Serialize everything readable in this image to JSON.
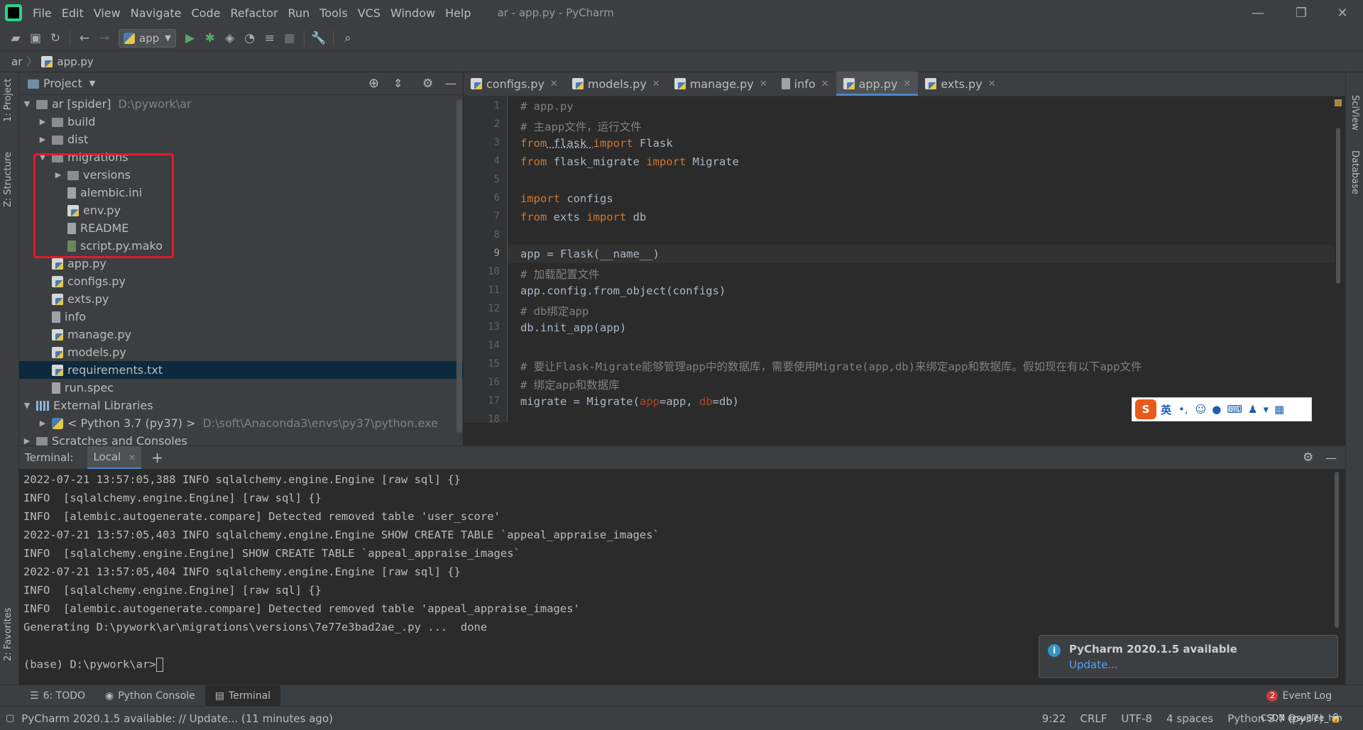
{
  "window": {
    "title": "ar - app.py - PyCharm"
  },
  "menu": [
    "File",
    "Edit",
    "View",
    "Navigate",
    "Code",
    "Refactor",
    "Run",
    "Tools",
    "VCS",
    "Window",
    "Help"
  ],
  "toolbar": {
    "run_config": "app"
  },
  "breadcrumb": {
    "root": "ar",
    "file": "app.py"
  },
  "left_strip": {
    "project": "1: Project",
    "structure": "Z: Structure",
    "favorites": "2: Favorites"
  },
  "right_strip": {
    "sciview": "SciView",
    "database": "Database"
  },
  "project_panel": {
    "title": "Project"
  },
  "tree": [
    {
      "label": "ar [spider]",
      "path": "D:\\pywork\\ar",
      "icon": "folder-icon",
      "arrow": "▼"
    },
    {
      "label": "build",
      "icon": "folder-icon",
      "arrow": "▶"
    },
    {
      "label": "dist",
      "icon": "folder-icon",
      "arrow": "▶"
    },
    {
      "label": "migrations",
      "icon": "folder-icon",
      "arrow": "▼"
    },
    {
      "label": "versions",
      "icon": "folder-icon",
      "arrow": "▶"
    },
    {
      "label": "alembic.ini",
      "icon": "ini-file-icon",
      "arrow": ""
    },
    {
      "label": "env.py",
      "icon": "python-file-icon",
      "arrow": ""
    },
    {
      "label": "README",
      "icon": "text-file-icon",
      "arrow": ""
    },
    {
      "label": "script.py.mako",
      "icon": "mako-file-icon",
      "arrow": ""
    },
    {
      "label": "app.py",
      "icon": "python-file-icon",
      "arrow": ""
    },
    {
      "label": "configs.py",
      "icon": "python-file-icon",
      "arrow": ""
    },
    {
      "label": "exts.py",
      "icon": "python-file-icon",
      "arrow": ""
    },
    {
      "label": "info",
      "icon": "text-file-icon",
      "arrow": ""
    },
    {
      "label": "manage.py",
      "icon": "python-file-icon",
      "arrow": ""
    },
    {
      "label": "models.py",
      "icon": "python-file-icon",
      "arrow": ""
    },
    {
      "label": "requirements.txt",
      "icon": "requirements-file-icon",
      "arrow": ""
    },
    {
      "label": "run.spec",
      "icon": "text-file-icon",
      "arrow": ""
    },
    {
      "label": "External Libraries",
      "icon": "library-icon",
      "arrow": "▼"
    },
    {
      "label": "< Python 3.7 (py37) >",
      "path": "D:\\soft\\Anaconda3\\envs\\py37\\python.exe",
      "icon": "python-sdk-icon",
      "arrow": "▶"
    },
    {
      "label": "Scratches and Consoles",
      "icon": "scratches-icon",
      "arrow": "▶"
    }
  ],
  "editor_tabs": [
    {
      "label": "configs.py",
      "active": false
    },
    {
      "label": "models.py",
      "active": false
    },
    {
      "label": "manage.py",
      "active": false
    },
    {
      "label": "info",
      "active": false
    },
    {
      "label": "app.py",
      "active": true
    },
    {
      "label": "exts.py",
      "active": false
    }
  ],
  "code_line_numbers": [
    "1",
    "2",
    "3",
    "4",
    "5",
    "6",
    "7",
    "8",
    "9",
    "10",
    "11",
    "12",
    "13",
    "14",
    "15",
    "16",
    "17",
    "18"
  ],
  "code": {
    "l1": "# app.py",
    "l2": "# 主app文件，运行文件",
    "l3a": "from",
    "l3b": " flask ",
    "l3c": "import",
    "l3d": " Flask",
    "l4a": "from",
    "l4b": " flask_migrate ",
    "l4c": "import",
    "l4d": " Migrate",
    "l6a": "import",
    "l6b": " configs",
    "l7a": "from",
    "l7b": " exts ",
    "l7c": "import",
    "l7d": " db",
    "l9": "app = Flask(__name__)",
    "l10": "# 加载配置文件",
    "l11": "app.config.from_object(configs)",
    "l12": "# db绑定app",
    "l13": "db.init_app(app)",
    "l15": "# 要让Flask-Migrate能够管理app中的数据库，需要使用Migrate(app,db)来绑定app和数据库。假如现在有以下app文件",
    "l16": "# 绑定app和数据库",
    "l17a": "migrate = Migrate(",
    "l17b": "app",
    "l17c": "=app, ",
    "l17d": "db",
    "l17e": "=db)"
  },
  "ime": {
    "lang": "英",
    "punct": "•,"
  },
  "terminal": {
    "title": "Terminal:",
    "tab": "Local",
    "lines": [
      "2022-07-21 13:57:05,388 INFO sqlalchemy.engine.Engine [raw sql] {}",
      "INFO  [sqlalchemy.engine.Engine] [raw sql] {}",
      "INFO  [alembic.autogenerate.compare] Detected removed table 'user_score'",
      "2022-07-21 13:57:05,403 INFO sqlalchemy.engine.Engine SHOW CREATE TABLE `appeal_appraise_images`",
      "INFO  [sqlalchemy.engine.Engine] SHOW CREATE TABLE `appeal_appraise_images`",
      "2022-07-21 13:57:05,404 INFO sqlalchemy.engine.Engine [raw sql] {}",
      "INFO  [sqlalchemy.engine.Engine] [raw sql] {}",
      "INFO  [alembic.autogenerate.compare] Detected removed table 'appeal_appraise_images'",
      "Generating D:\\pywork\\ar\\migrations\\versions\\7e77e3bad2ae_.py ...  done",
      "",
      "(base) D:\\pywork\\ar>"
    ]
  },
  "notification": {
    "title": "PyCharm 2020.1.5 available",
    "link": "Update..."
  },
  "tool_windows": {
    "todo": "6: TODO",
    "console": "Python Console",
    "terminal": "Terminal",
    "event_log": "Event Log",
    "event_count": "2"
  },
  "status": {
    "message": "PyCharm 2020.1.5 available: // Update... (11 minutes ago)",
    "position": "9:22",
    "line_sep": "CRLF",
    "encoding": "UTF-8",
    "indent": "4 spaces",
    "interpreter": "Python 3.7 (py37)",
    "watermark": "CSDN @suelee_hm"
  }
}
